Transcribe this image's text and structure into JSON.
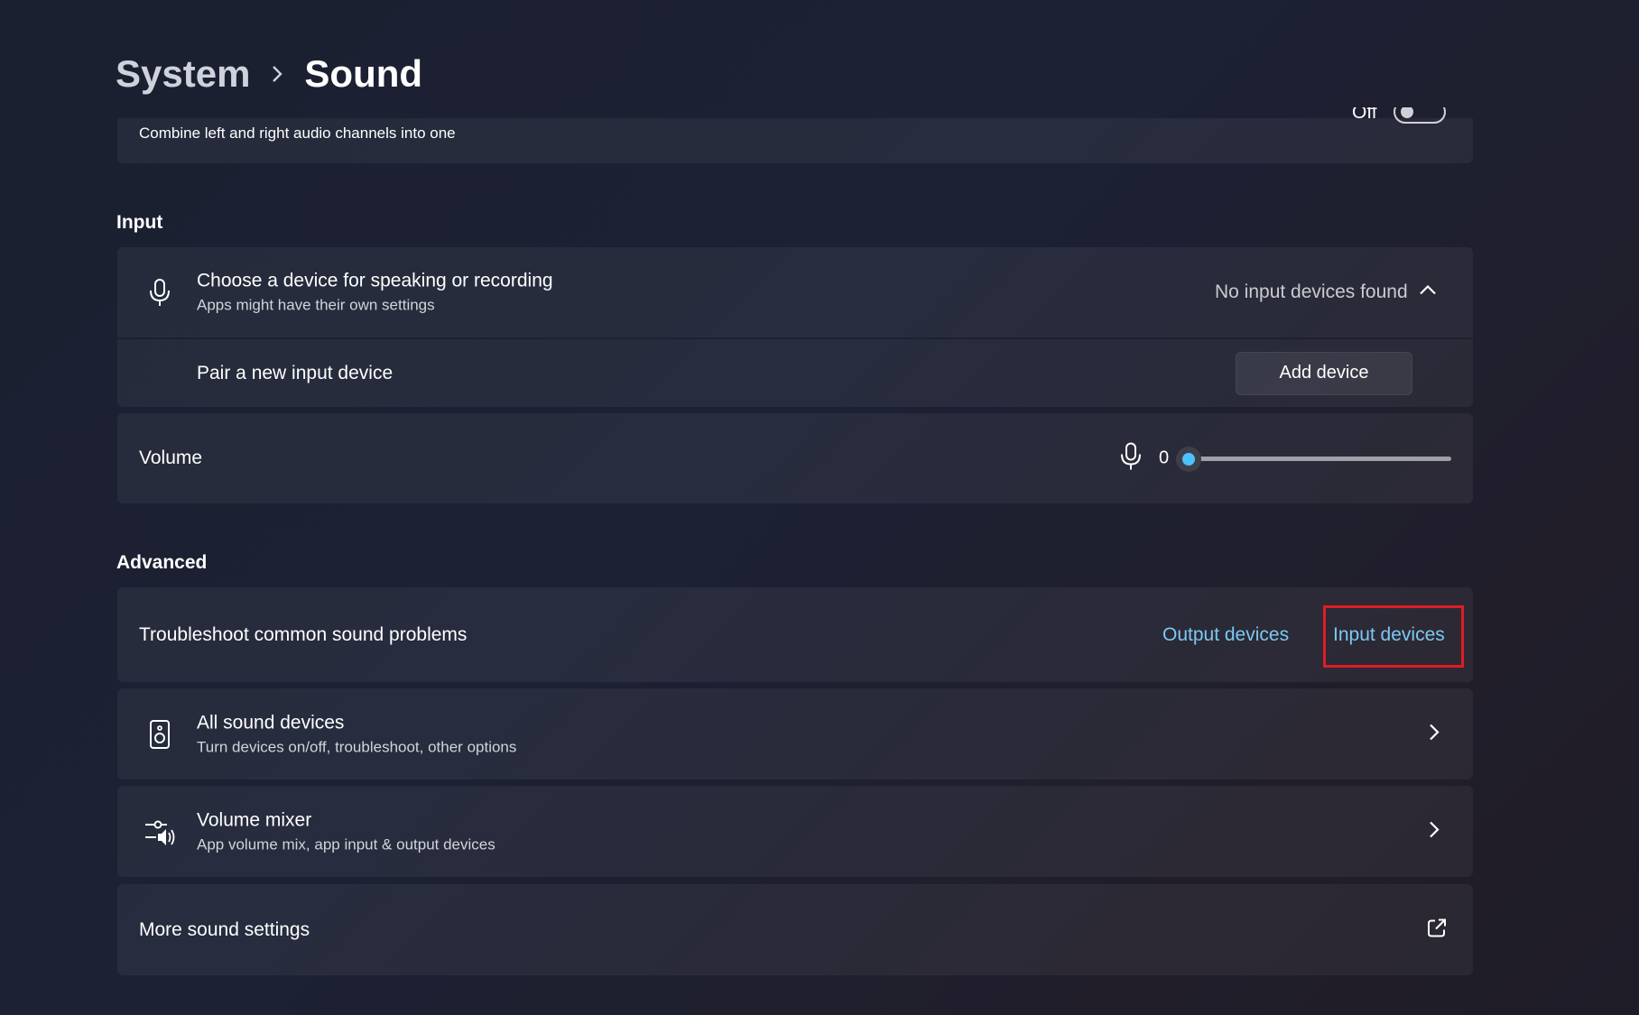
{
  "breadcrumb": {
    "parent": "System",
    "current": "Sound"
  },
  "mono_audio": {
    "description": "Combine left and right audio channels into one",
    "toggle_label": "Off"
  },
  "input": {
    "section_title": "Input",
    "choose_device": {
      "title": "Choose a device for speaking or recording",
      "subtitle": "Apps might have their own settings",
      "status": "No input devices found"
    },
    "pair_device": {
      "label": "Pair a new input device",
      "button": "Add device"
    },
    "volume": {
      "label": "Volume",
      "value": "0",
      "level": 0
    }
  },
  "advanced": {
    "section_title": "Advanced",
    "troubleshoot": {
      "label": "Troubleshoot common sound problems",
      "output_link": "Output devices",
      "input_link": "Input devices"
    },
    "all_devices": {
      "title": "All sound devices",
      "subtitle": "Turn devices on/off, troubleshoot, other options"
    },
    "mixer": {
      "title": "Volume mixer",
      "subtitle": "App volume mix, app input & output devices"
    },
    "more_settings": {
      "label": "More sound settings"
    }
  },
  "colors": {
    "accent": "#4cc2ff",
    "link": "#7dc8f0",
    "highlight": "#e01c25"
  }
}
